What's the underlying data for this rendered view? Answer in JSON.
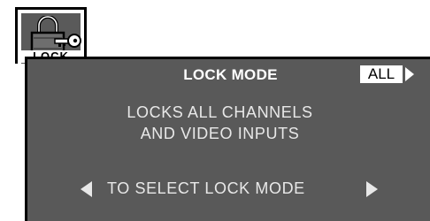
{
  "lock_tab": {
    "label": "LOCK",
    "icon": "padlock-key-icon"
  },
  "panel": {
    "title": "LOCK MODE",
    "mode_value": "ALL",
    "description_line1": "LOCKS ALL CHANNELS",
    "description_line2": "AND VIDEO INPUTS",
    "instruction": "TO SELECT LOCK MODE"
  },
  "colors": {
    "panel_background": "#595959",
    "text": "#e8e8e8",
    "highlight": "#ffffff"
  }
}
